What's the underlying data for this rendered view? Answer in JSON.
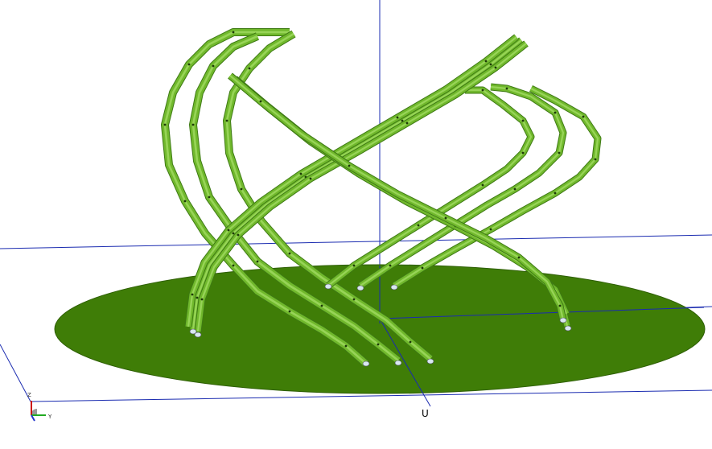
{
  "viewport": {
    "background_color": "#ffffff",
    "grid_line_color": "#1a2bb0",
    "platform_color": "#3f7d07",
    "platform_edge_color": "#2d5e03",
    "tube_color": "#70b82c",
    "tube_highlight_color": "#a8e06a",
    "tube_shadow_color": "#3e7a14",
    "joint_color": "#1d3a08",
    "foot_color": "#d8e8f0"
  },
  "labels": {
    "u": "U",
    "axis_z": "Z",
    "axis_y": "Y"
  },
  "axis_triad": {
    "z_color": "#cc1111",
    "y_color": "#22aa22",
    "x_color": "#2233cc"
  }
}
